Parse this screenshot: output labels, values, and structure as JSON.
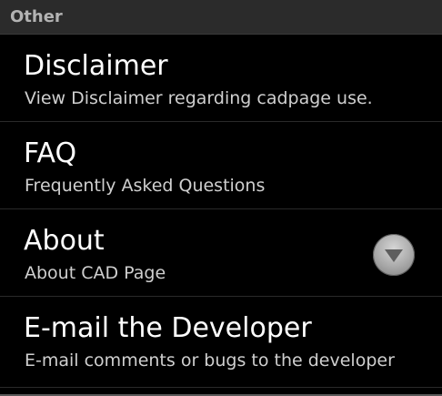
{
  "section": {
    "title": "Other"
  },
  "items": [
    {
      "title": "Disclaimer",
      "summary": "View Disclaimer regarding cadpage use."
    },
    {
      "title": "FAQ",
      "summary": "Frequently Asked Questions"
    },
    {
      "title": "About",
      "summary": "About CAD Page",
      "icon": "chevron-down-icon"
    },
    {
      "title": "E-mail the Developer",
      "summary": "E-mail comments or bugs to the developer"
    }
  ]
}
